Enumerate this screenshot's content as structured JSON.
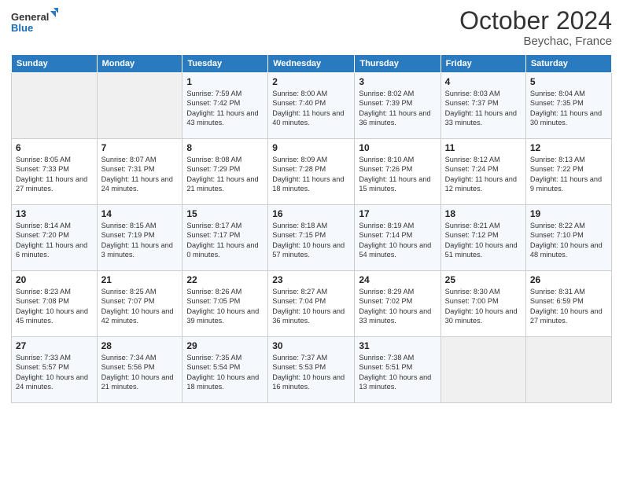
{
  "header": {
    "logo_line1": "General",
    "logo_line2": "Blue",
    "month": "October 2024",
    "location": "Beychac, France"
  },
  "days_of_week": [
    "Sunday",
    "Monday",
    "Tuesday",
    "Wednesday",
    "Thursday",
    "Friday",
    "Saturday"
  ],
  "weeks": [
    [
      {
        "day": "",
        "info": ""
      },
      {
        "day": "",
        "info": ""
      },
      {
        "day": "1",
        "info": "Sunrise: 7:59 AM\nSunset: 7:42 PM\nDaylight: 11 hours and 43 minutes."
      },
      {
        "day": "2",
        "info": "Sunrise: 8:00 AM\nSunset: 7:40 PM\nDaylight: 11 hours and 40 minutes."
      },
      {
        "day": "3",
        "info": "Sunrise: 8:02 AM\nSunset: 7:39 PM\nDaylight: 11 hours and 36 minutes."
      },
      {
        "day": "4",
        "info": "Sunrise: 8:03 AM\nSunset: 7:37 PM\nDaylight: 11 hours and 33 minutes."
      },
      {
        "day": "5",
        "info": "Sunrise: 8:04 AM\nSunset: 7:35 PM\nDaylight: 11 hours and 30 minutes."
      }
    ],
    [
      {
        "day": "6",
        "info": "Sunrise: 8:05 AM\nSunset: 7:33 PM\nDaylight: 11 hours and 27 minutes."
      },
      {
        "day": "7",
        "info": "Sunrise: 8:07 AM\nSunset: 7:31 PM\nDaylight: 11 hours and 24 minutes."
      },
      {
        "day": "8",
        "info": "Sunrise: 8:08 AM\nSunset: 7:29 PM\nDaylight: 11 hours and 21 minutes."
      },
      {
        "day": "9",
        "info": "Sunrise: 8:09 AM\nSunset: 7:28 PM\nDaylight: 11 hours and 18 minutes."
      },
      {
        "day": "10",
        "info": "Sunrise: 8:10 AM\nSunset: 7:26 PM\nDaylight: 11 hours and 15 minutes."
      },
      {
        "day": "11",
        "info": "Sunrise: 8:12 AM\nSunset: 7:24 PM\nDaylight: 11 hours and 12 minutes."
      },
      {
        "day": "12",
        "info": "Sunrise: 8:13 AM\nSunset: 7:22 PM\nDaylight: 11 hours and 9 minutes."
      }
    ],
    [
      {
        "day": "13",
        "info": "Sunrise: 8:14 AM\nSunset: 7:20 PM\nDaylight: 11 hours and 6 minutes."
      },
      {
        "day": "14",
        "info": "Sunrise: 8:15 AM\nSunset: 7:19 PM\nDaylight: 11 hours and 3 minutes."
      },
      {
        "day": "15",
        "info": "Sunrise: 8:17 AM\nSunset: 7:17 PM\nDaylight: 11 hours and 0 minutes."
      },
      {
        "day": "16",
        "info": "Sunrise: 8:18 AM\nSunset: 7:15 PM\nDaylight: 10 hours and 57 minutes."
      },
      {
        "day": "17",
        "info": "Sunrise: 8:19 AM\nSunset: 7:14 PM\nDaylight: 10 hours and 54 minutes."
      },
      {
        "day": "18",
        "info": "Sunrise: 8:21 AM\nSunset: 7:12 PM\nDaylight: 10 hours and 51 minutes."
      },
      {
        "day": "19",
        "info": "Sunrise: 8:22 AM\nSunset: 7:10 PM\nDaylight: 10 hours and 48 minutes."
      }
    ],
    [
      {
        "day": "20",
        "info": "Sunrise: 8:23 AM\nSunset: 7:08 PM\nDaylight: 10 hours and 45 minutes."
      },
      {
        "day": "21",
        "info": "Sunrise: 8:25 AM\nSunset: 7:07 PM\nDaylight: 10 hours and 42 minutes."
      },
      {
        "day": "22",
        "info": "Sunrise: 8:26 AM\nSunset: 7:05 PM\nDaylight: 10 hours and 39 minutes."
      },
      {
        "day": "23",
        "info": "Sunrise: 8:27 AM\nSunset: 7:04 PM\nDaylight: 10 hours and 36 minutes."
      },
      {
        "day": "24",
        "info": "Sunrise: 8:29 AM\nSunset: 7:02 PM\nDaylight: 10 hours and 33 minutes."
      },
      {
        "day": "25",
        "info": "Sunrise: 8:30 AM\nSunset: 7:00 PM\nDaylight: 10 hours and 30 minutes."
      },
      {
        "day": "26",
        "info": "Sunrise: 8:31 AM\nSunset: 6:59 PM\nDaylight: 10 hours and 27 minutes."
      }
    ],
    [
      {
        "day": "27",
        "info": "Sunrise: 7:33 AM\nSunset: 5:57 PM\nDaylight: 10 hours and 24 minutes."
      },
      {
        "day": "28",
        "info": "Sunrise: 7:34 AM\nSunset: 5:56 PM\nDaylight: 10 hours and 21 minutes."
      },
      {
        "day": "29",
        "info": "Sunrise: 7:35 AM\nSunset: 5:54 PM\nDaylight: 10 hours and 18 minutes."
      },
      {
        "day": "30",
        "info": "Sunrise: 7:37 AM\nSunset: 5:53 PM\nDaylight: 10 hours and 16 minutes."
      },
      {
        "day": "31",
        "info": "Sunrise: 7:38 AM\nSunset: 5:51 PM\nDaylight: 10 hours and 13 minutes."
      },
      {
        "day": "",
        "info": ""
      },
      {
        "day": "",
        "info": ""
      }
    ]
  ]
}
